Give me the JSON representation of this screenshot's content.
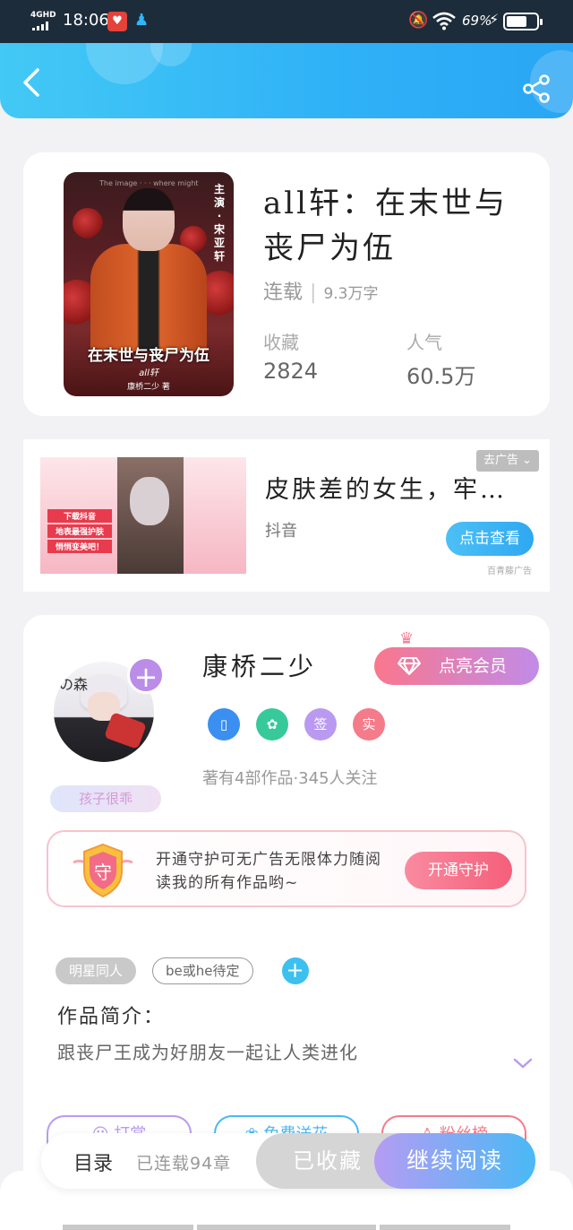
{
  "status_bar": {
    "network": "4GHD",
    "time": "18:06",
    "battery_percent": "69%",
    "battery_level": 0.69,
    "app_icons": [
      "red-heart-app-icon",
      "qq-penguin-icon"
    ]
  },
  "header": {
    "back_icon": "chevron-left-icon",
    "share_icon": "share-icon"
  },
  "book": {
    "title": "all轩：在末世与丧尸为伍",
    "status": "连载",
    "word_count": "9.3万字",
    "favorites_label": "收藏",
    "favorites_value": "2824",
    "popularity_label": "人气",
    "popularity_value": "60.5万",
    "cover": {
      "side_text": "主演·宋亚轩",
      "title": "在末世与丧尸为伍",
      "subtitle": "all轩",
      "author": "康桥二少 著",
      "top_text": "The image · · · where might"
    }
  },
  "ad": {
    "title": "皮肤差的女生，牢…",
    "source": "抖音",
    "close_tag": "去广告",
    "button": "点击查看",
    "note": "百青藤广告",
    "stickers": [
      "下载抖音",
      "地表最强护肤",
      "悄悄变美吧！"
    ]
  },
  "author": {
    "name": "康桥二少",
    "vip_button": "点亮会员",
    "nickname_badge": "孩子很乖",
    "avatar_mark": "の森",
    "stats": "著有4部作品·345人关注",
    "badges": [
      {
        "label": "",
        "icon": "phone-badge-icon",
        "color": "#3b8ff0"
      },
      {
        "label": "",
        "icon": "handshake-badge-icon",
        "color": "#38c99a"
      },
      {
        "label": "签",
        "icon": "sign-badge-icon",
        "color": "#b99af0"
      },
      {
        "label": "实",
        "icon": "verified-badge-icon",
        "color": "#f47b8a"
      }
    ]
  },
  "guard": {
    "badge_char": "守",
    "text": "开通守护可无广告无限体力随阅读我的所有作品哟~",
    "button": "开通守护"
  },
  "tags": [
    "明星同人",
    "be或he待定"
  ],
  "intro": {
    "label": "作品简介：",
    "text": "跟丧尸王成为好朋友一起让人类进化"
  },
  "actions": [
    {
      "label": "打赏",
      "icon": "gift-icon",
      "color": "#b99af0"
    },
    {
      "label": "免费送花",
      "icon": "flower-icon",
      "color": "#49b9f5"
    },
    {
      "label": "粉丝榜",
      "icon": "person-icon",
      "color": "#f47b8a"
    }
  ],
  "bottom_bar": {
    "toc": "目录",
    "chapters": "已连载94章",
    "favorited": "已收藏",
    "continue_reading": "继续阅读"
  }
}
